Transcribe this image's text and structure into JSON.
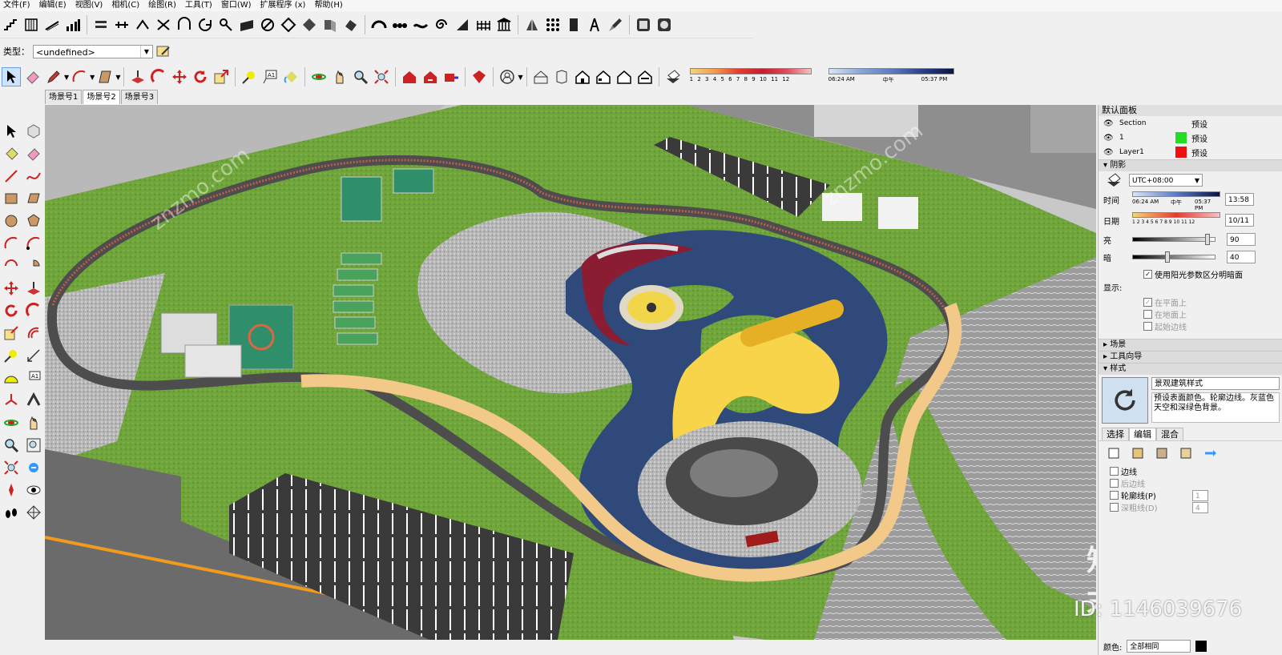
{
  "menu": [
    "文件(F)",
    "编辑(E)",
    "视图(V)",
    "相机(C)",
    "绘图(R)",
    "工具(T)",
    "窗口(W)",
    "扩展程序 (x)",
    "帮助(H)"
  ],
  "typebar": {
    "label": "类型：",
    "value": "<undefined>"
  },
  "shadow_gradient_toolbar": {
    "ticks": [
      "1",
      "2",
      "3",
      "4",
      "5",
      "6",
      "7",
      "8",
      "9",
      "10",
      "11",
      "12"
    ],
    "start": "06:24 AM",
    "mid": "中午",
    "end": "05:37 PM"
  },
  "scene_tabs": [
    "场景号1",
    "场景号2",
    "场景号3"
  ],
  "panel": {
    "title": "默认面板",
    "layers": [
      {
        "name": "Section",
        "value": "预设",
        "color": ""
      },
      {
        "name": "1",
        "value": "预设",
        "color": "#22dd22"
      },
      {
        "name": "Layer1",
        "value": "预设",
        "color": "#ee1111"
      }
    ],
    "shadow": {
      "header": "阴影",
      "timezone": "UTC+08:00",
      "time_label": "时间",
      "time_start": "06:24 AM",
      "time_mid": "中午",
      "time_end": "05:37 PM",
      "time_value": "13:58",
      "date_label": "日期",
      "date_ticks": "1 2 3 4 5 6 7 8 9 10 11 12",
      "date_value": "10/11",
      "light_label": "亮",
      "light_value": "90",
      "light_level": 0.9,
      "dark_label": "暗",
      "dark_value": "40",
      "dark_level": 0.4,
      "sun_checkbox": "使用阳光参数区分明暗面",
      "display_label": "显示:",
      "display_options": [
        "在平面上",
        "在地面上",
        "起始边线"
      ]
    },
    "sections": [
      "场景",
      "工具向导"
    ],
    "style": {
      "header": "样式",
      "name": "景观建筑样式",
      "description": "预设表面颜色。轮廓边线。灰蓝色天空和深绿色背景。",
      "tabs": [
        "选择",
        "编辑",
        "混合"
      ],
      "edge_options": [
        {
          "label": "边线",
          "enabled": true,
          "value": ""
        },
        {
          "label": "后边线",
          "enabled": false,
          "value": ""
        },
        {
          "label": "轮廓线(P)",
          "enabled": true,
          "value": "1"
        },
        {
          "label": "深粗线(D)",
          "enabled": false,
          "value": "4"
        }
      ],
      "bottom_label": "颜色:",
      "bottom_value": "全部相同"
    }
  },
  "watermark": {
    "logo": "知末",
    "id": "ID: 1146039676",
    "site": "znzmo.com"
  }
}
